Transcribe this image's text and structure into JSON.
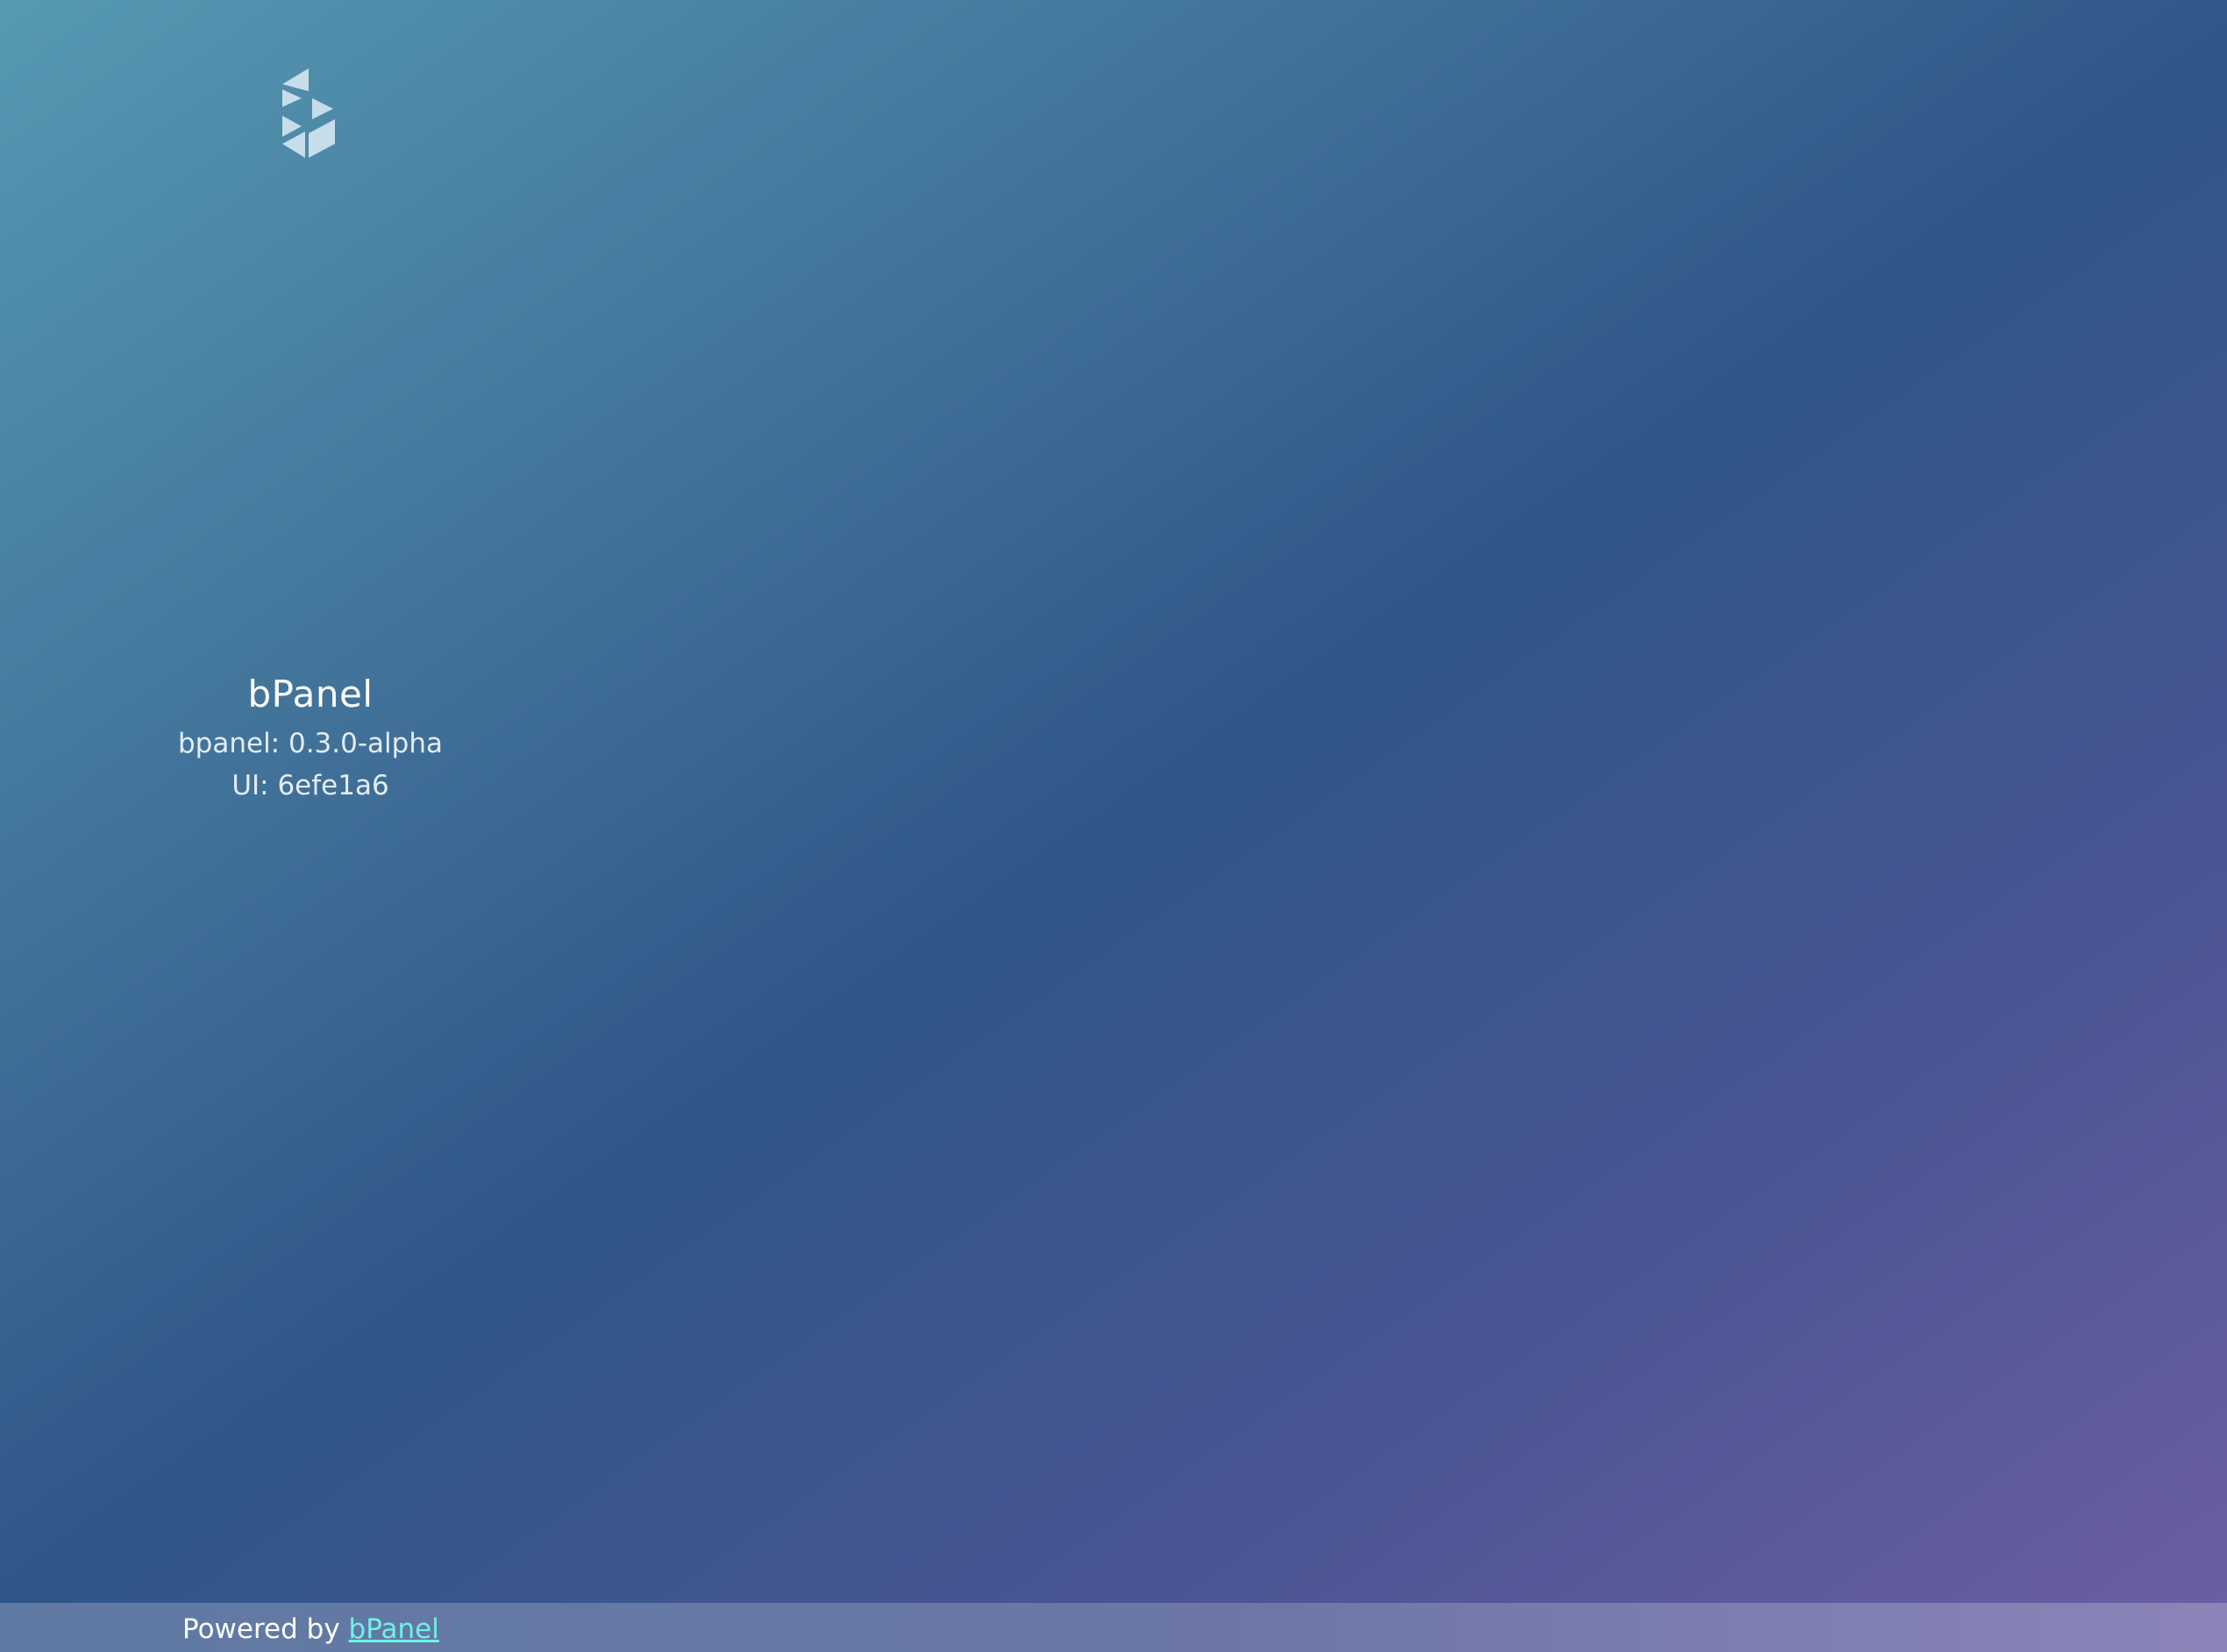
{
  "brand": {
    "logo_icon": "bpanel-logo-icon",
    "title": "bPanel",
    "bpanel_version": "bpanel: 0.3.0-alpha",
    "ui_version": "UI: 6efe1a6"
  },
  "footer": {
    "powered_by": "Powered by",
    "link_label": "bPanel"
  },
  "colors": {
    "link": "#6ff1e6",
    "logo": "#d5e6f0",
    "footer_bg": "#6c77a6"
  }
}
